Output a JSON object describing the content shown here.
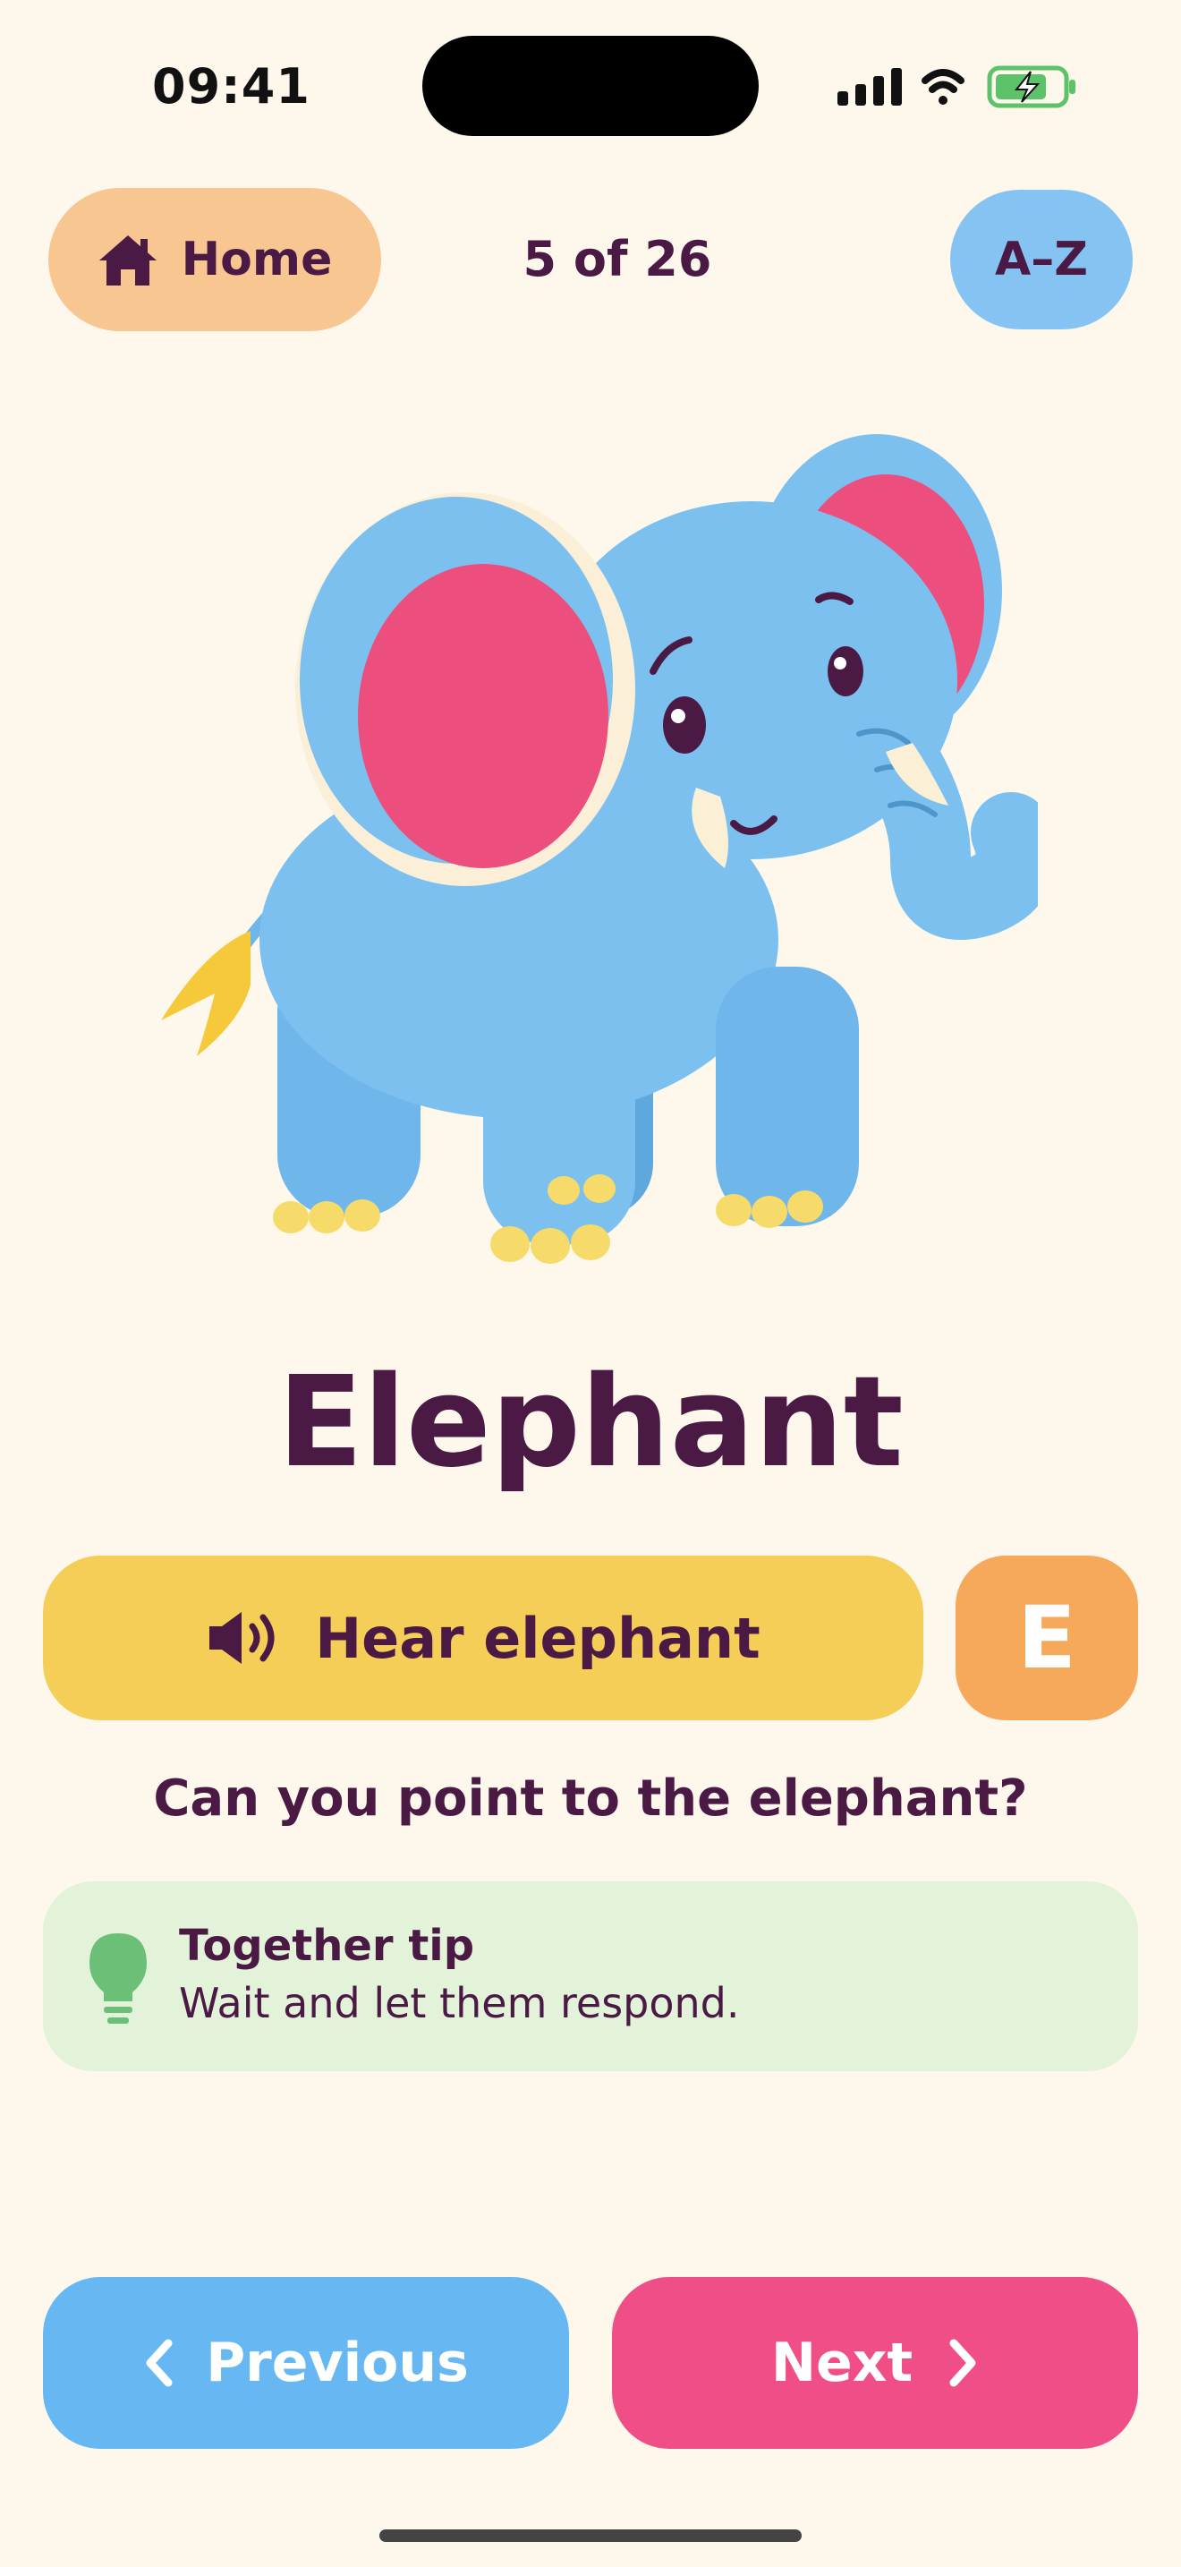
{
  "status_bar": {
    "time": "09:41",
    "icons": [
      "signal-icon",
      "wifi-icon",
      "battery-charging-icon"
    ]
  },
  "top_bar": {
    "home_label": "Home",
    "counter": "5 of 26",
    "az_label": "A–Z"
  },
  "card": {
    "illustration": "elephant-illustration",
    "word": "Elephant",
    "hear_label": "Hear elephant",
    "letter": "E",
    "prompt": "Can you point to the elephant?"
  },
  "tip": {
    "title": "Together tip",
    "text": "Wait and let them respond."
  },
  "nav": {
    "previous_label": "Previous",
    "next_label": "Next"
  },
  "colors": {
    "background": "#FDF7EC",
    "text": "#4A1A45",
    "home_button": "#F8C690",
    "az_button": "#84C3F2",
    "hear_button": "#F5CE58",
    "letter_badge": "#F6A95B",
    "tip_card": "#E2F3D9",
    "tip_icon": "#6CBF77",
    "previous_button": "#67B8F2",
    "next_button": "#EF4E86"
  }
}
